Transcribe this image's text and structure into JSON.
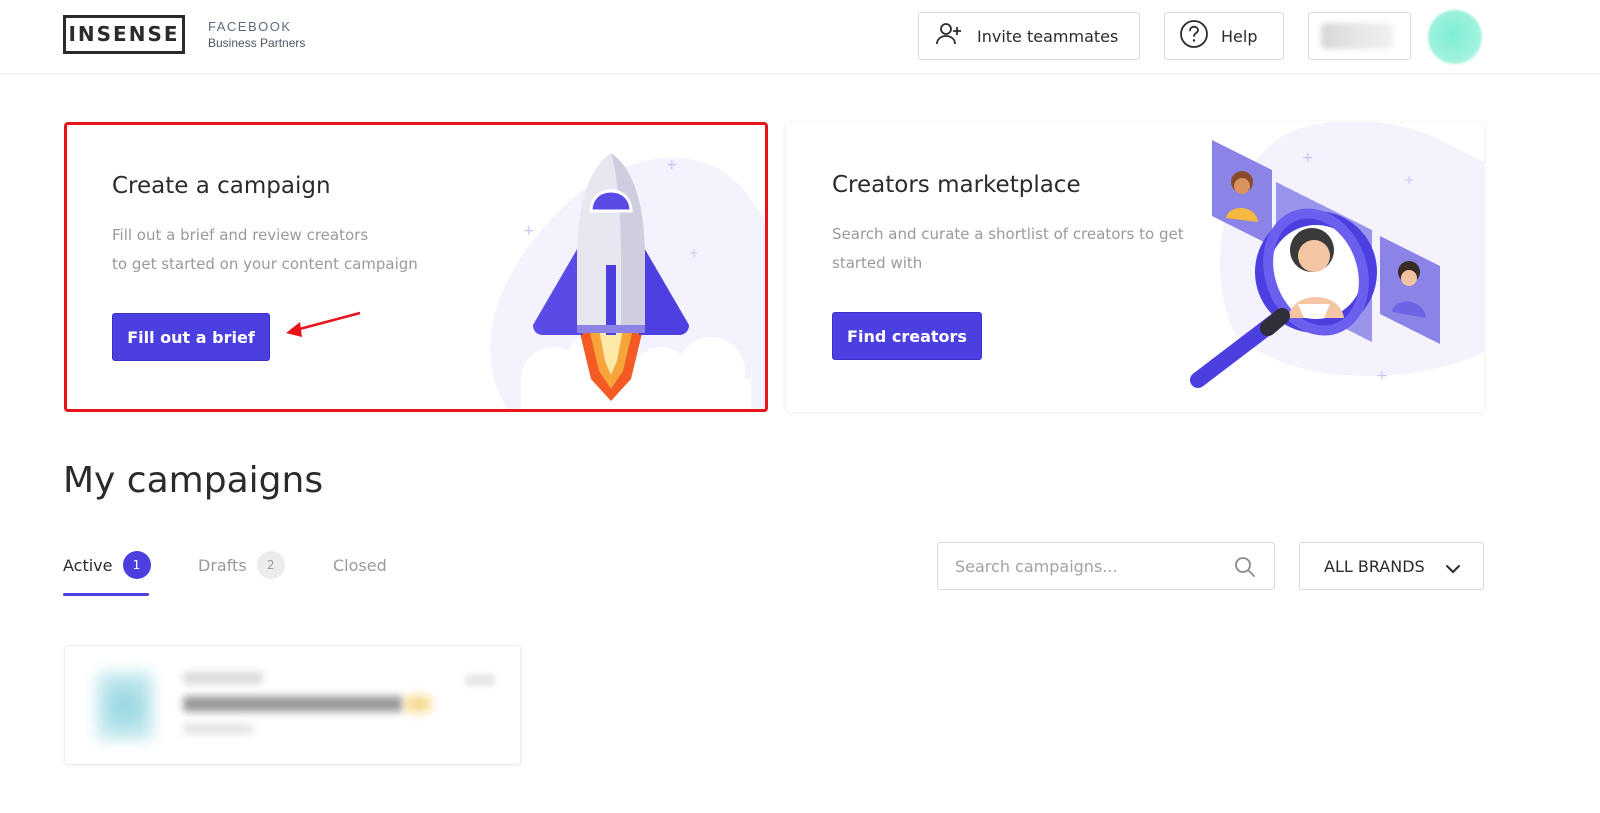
{
  "header": {
    "logo_text": "INSENSE",
    "partner_top": "FACEBOOK",
    "partner_bottom": "Business Partners",
    "invite_label": "Invite teammates",
    "help_label": "Help"
  },
  "cards": {
    "campaign": {
      "title": "Create a campaign",
      "desc_line1": "Fill out a brief and review creators",
      "desc_line2": "to get started on your content campaign",
      "button_label": "Fill out a brief"
    },
    "marketplace": {
      "title": "Creators marketplace",
      "desc_line1": "Search and curate a shortlist of creators to get",
      "desc_line2": "started with",
      "button_label": "Find creators"
    }
  },
  "campaigns": {
    "title": "My campaigns",
    "tabs": [
      {
        "label": "Active",
        "count": "1"
      },
      {
        "label": "Drafts",
        "count": "2"
      },
      {
        "label": "Closed"
      }
    ],
    "search_placeholder": "Search campaigns...",
    "brands_label": "ALL BRANDS"
  },
  "colors": {
    "primary": "#4c3fe0",
    "highlight": "#e8141b"
  },
  "icons": {
    "invite": "add-user-icon",
    "help": "question-circle-icon",
    "search": "search-icon",
    "dropdown": "chevron-down-icon"
  }
}
